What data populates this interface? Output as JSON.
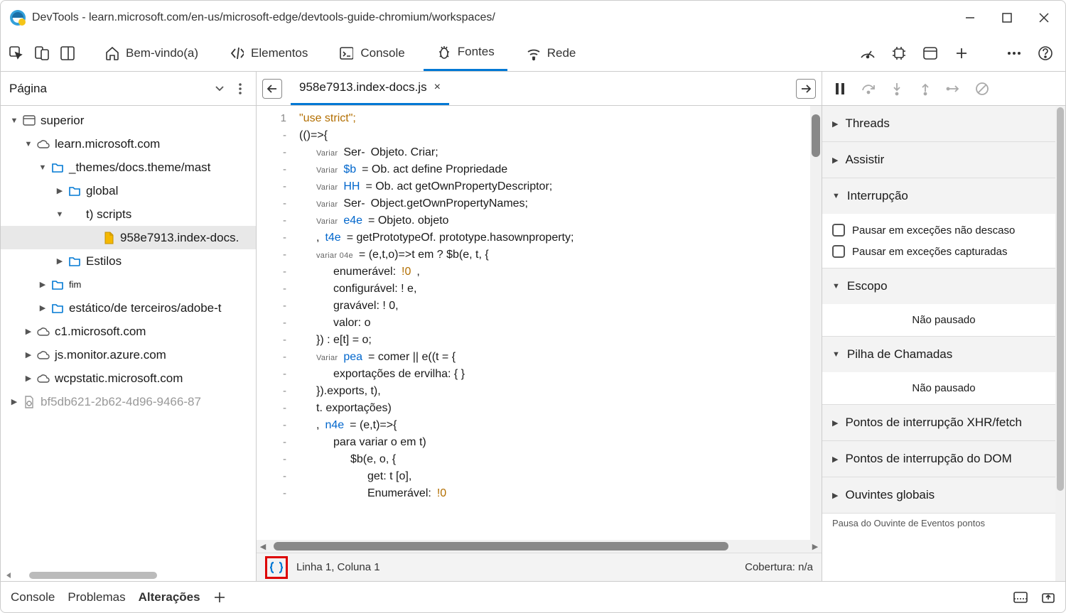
{
  "window": {
    "title": "DevTools - learn.microsoft.com/en-us/microsoft-edge/devtools-guide-chromium/workspaces/"
  },
  "tabs": {
    "welcome": "Bem-vindo(a)",
    "elements": "Elementos",
    "console": "Console",
    "sources": "Fontes",
    "network": "Rede"
  },
  "sidebar": {
    "page_label": "Página",
    "tree": [
      {
        "indent": 0,
        "tri": "down",
        "icon": "window",
        "label": "superior"
      },
      {
        "indent": 1,
        "tri": "down",
        "icon": "cloud",
        "label": "learn.microsoft.com"
      },
      {
        "indent": 2,
        "tri": "down",
        "icon": "folder",
        "label": "_themes/docs.theme/mast"
      },
      {
        "indent": 3,
        "tri": "right",
        "icon": "folder",
        "label": "global"
      },
      {
        "indent": 3,
        "tri": "down",
        "icon": "none",
        "label": "t) scripts"
      },
      {
        "indent": 5,
        "tri": "none",
        "icon": "file",
        "label": "958e7913.index-docs.",
        "sel": true
      },
      {
        "indent": 3,
        "tri": "right",
        "icon": "folder",
        "label": "Estilos"
      },
      {
        "indent": 2,
        "tri": "right",
        "icon": "folder",
        "label": "fim",
        "small": true
      },
      {
        "indent": 2,
        "tri": "right",
        "icon": "folder",
        "label": "estático/de terceiros/adobe-t"
      },
      {
        "indent": 1,
        "tri": "right",
        "icon": "cloud",
        "label": "c1.microsoft.com"
      },
      {
        "indent": 1,
        "tri": "right",
        "icon": "cloud",
        "label": "js.monitor.azure.com"
      },
      {
        "indent": 1,
        "tri": "right",
        "icon": "cloud",
        "label": "wcpstatic.microsoft.com"
      },
      {
        "indent": 0,
        "tri": "right",
        "icon": "service",
        "label": "bf5db621-2b62-4d96-9466-87",
        "muted": true
      }
    ]
  },
  "editor": {
    "file_tab": "958e7913.index-docs.js",
    "gutter_first": "1",
    "gutter_dash": "-",
    "status_line": "Linha 1, Coluna 1",
    "coverage": "Cobertura: n/a",
    "code_lines": [
      {
        "indent": 0,
        "raw": "\"use strict\";",
        "cls": "lit"
      },
      {
        "indent": 0,
        "raw": "(()=>{"
      },
      {
        "indent": 2,
        "small": "Variar",
        "parts": [
          {
            "t": "Ser- ",
            "cls": ""
          },
          {
            "t": "  Objeto. Criar;"
          }
        ]
      },
      {
        "indent": 2,
        "small": "Variar",
        "parts": [
          {
            "t": "$b",
            "cls": "kw"
          },
          {
            "t": " =  Ob. act define Propriedade"
          }
        ]
      },
      {
        "indent": 2,
        "small": "Variar",
        "parts": [
          {
            "t": "HH",
            "cls": "kw"
          },
          {
            "t": " =  Ob. act getOwnPropertyDescriptor;"
          }
        ]
      },
      {
        "indent": 2,
        "small": "Variar",
        "parts": [
          {
            "t": "Ser- ",
            "cls": ""
          },
          {
            "t": "  Object.getOwnPropertyNames;"
          }
        ]
      },
      {
        "indent": 2,
        "small": "Variar",
        "parts": [
          {
            "t": "e4e",
            "cls": "kw"
          },
          {
            "t": " =  Objeto. objeto"
          }
        ]
      },
      {
        "indent": 2,
        "parts": [
          {
            "t": "  ,  "
          },
          {
            "t": "t4e",
            "cls": "kw"
          },
          {
            "t": " =  getPrototypeOf. prototype.hasownproperty;"
          }
        ]
      },
      {
        "indent": 2,
        "small": "variar 04e",
        "parts": [
          {
            "t": "   = (e,t,o)=>t  em    ? $b(e, t, {"
          }
        ]
      },
      {
        "indent": 4,
        "parts": [
          {
            "t": "enumerável:     "
          },
          {
            "t": "!0",
            "cls": "lit"
          },
          {
            "t": ","
          }
        ]
      },
      {
        "indent": 4,
        "parts": [
          {
            "t": "configurável: ! e,"
          }
        ]
      },
      {
        "indent": 4,
        "parts": [
          {
            "t": "gravável: ! 0,"
          }
        ]
      },
      {
        "indent": 4,
        "parts": [
          {
            "t": "valor: o"
          }
        ]
      },
      {
        "indent": 2,
        "parts": [
          {
            "t": "}) :  e[t] = o;"
          }
        ]
      },
      {
        "indent": 2,
        "small": "Variar",
        "parts": [
          {
            "t": "pea",
            "cls": "kw"
          },
          {
            "t": "  =  comer        || e((t = {"
          }
        ]
      },
      {
        "indent": 4,
        "parts": [
          {
            "t": "exportações de ervilha: { }"
          }
        ]
      },
      {
        "indent": 2,
        "parts": [
          {
            "t": "}).exports, t),"
          }
        ]
      },
      {
        "indent": 2,
        "parts": [
          {
            "t": "t. exportações)"
          }
        ]
      },
      {
        "indent": 2,
        "parts": [
          {
            "t": "  ,  "
          },
          {
            "t": "n4e",
            "cls": "kw"
          },
          {
            "t": " =  (e,t)=>{"
          }
        ]
      },
      {
        "indent": 4,
        "parts": [
          {
            "t": "para variar o em t)"
          }
        ]
      },
      {
        "indent": 6,
        "parts": [
          {
            "t": "$b(e, o, {"
          }
        ]
      },
      {
        "indent": 8,
        "parts": [
          {
            "t": "get: t [o],"
          }
        ]
      },
      {
        "indent": 8,
        "parts": [
          {
            "t": "Enumerável:     "
          },
          {
            "t": "!0",
            "cls": "lit"
          }
        ]
      }
    ]
  },
  "debugger": {
    "sections": {
      "threads": "Threads",
      "watch": "Assistir",
      "breakpoints": "Interrupção",
      "pause_unexc": "Pausar em exceções não descaso",
      "pause_caught": "Pausar em exceções capturadas",
      "scope": "Escopo",
      "not_paused": "Não pausado",
      "callstack": "Pilha de Chamadas",
      "xhr": "Pontos de interrupção XHR/fetch",
      "dom": "Pontos de interrupção do DOM",
      "listeners": "Ouvintes globais",
      "event_listener": "Pausa do Ouvinte de Eventos",
      "points_suffix": "pontos"
    }
  },
  "drawer": {
    "console": "Console",
    "problems": "Problemas",
    "changes": "Alterações"
  }
}
